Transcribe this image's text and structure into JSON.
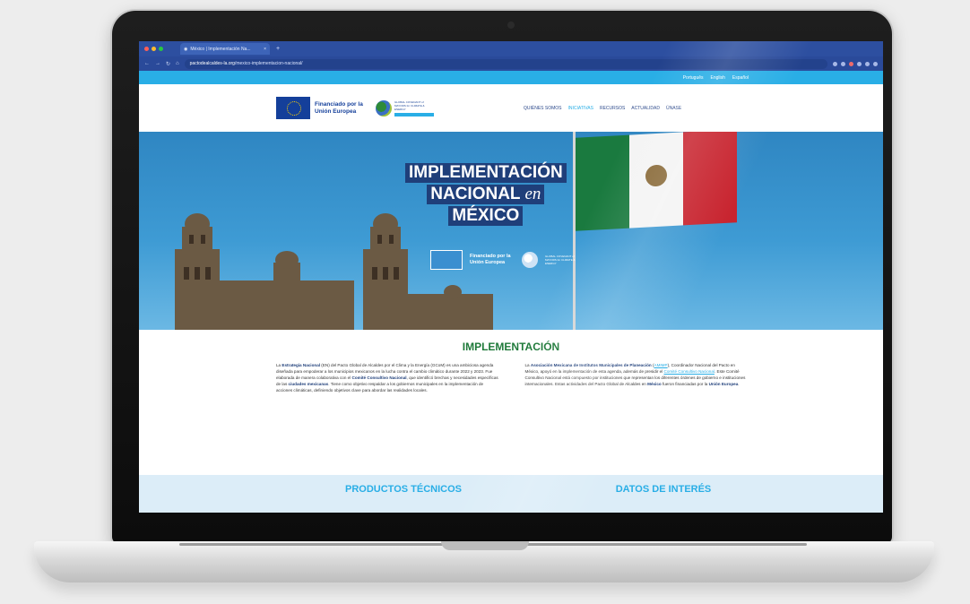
{
  "browser": {
    "tab_title": "México | Implementación Na...",
    "new_tab": "+",
    "url_domain": "pactodealcaldes-la.org",
    "url_path": "/mexico-implementacion-nacional/"
  },
  "lang_bar": [
    "Português",
    "English",
    "Español"
  ],
  "eu_logo": {
    "text": "Financiado por la Unión Europea"
  },
  "gcom_logo": {
    "text": "GLOBAL COVENANT of MAYORS for CLIMATE & ENERGY"
  },
  "nav": {
    "items": [
      {
        "label": "QUIÉNES SOMOS",
        "active": false
      },
      {
        "label": "INICIATIVAS",
        "active": true
      },
      {
        "label": "RECURSOS",
        "active": false
      },
      {
        "label": "ACTUALIDAD",
        "active": false
      },
      {
        "label": "ÚNASE",
        "active": false
      }
    ]
  },
  "hero": {
    "line1": "IMPLEMENTACIÓN",
    "line2a": "NACIONAL",
    "line2b": "en",
    "line3": "MÉXICO",
    "eu_text": "Financiado por la Unión Europea",
    "gcom_text": "GLOBAL COVENANT of MAYORS for CLIMATE & ENERGY"
  },
  "section": {
    "title": "IMPLEMENTACIÓN",
    "col1": [
      {
        "t": "La ",
        "s": "n"
      },
      {
        "t": "Estrategia Nacional",
        "s": "b"
      },
      {
        "t": " (EN) del Pacto Global de Alcaldes por el Clima y la Energía (GCoM) es una ambiciosa agenda diseñada para empoderar a los municipios mexicanos en la lucha contra el cambio climático durante 2022 y 2023. Fue elaborada de manera colaborativa con el ",
        "s": "n"
      },
      {
        "t": "Comité Consultivo Nacional",
        "s": "b"
      },
      {
        "t": ", que identificó brechas y necesidades específicas de las ",
        "s": "n"
      },
      {
        "t": "ciudades mexicanas",
        "s": "b"
      },
      {
        "t": ". Tiene como objetivo respaldar a los gobiernos municipales en la implementación de acciones climáticas, definiendo objetivos clave para abordar las realidades locales.",
        "s": "n"
      }
    ],
    "col2": [
      {
        "t": "La ",
        "s": "n"
      },
      {
        "t": "Asociación Mexicana de Institutos Municipales de Planeación",
        "s": "b"
      },
      {
        "t": " (",
        "s": "n"
      },
      {
        "t": "AMIMP",
        "s": "l"
      },
      {
        "t": "), Coordinador Nacional del Pacto en México, apoyó en la implementación de esta agenda, además de presidir el ",
        "s": "n"
      },
      {
        "t": "Comité Consultivo Nacional",
        "s": "l"
      },
      {
        "t": ". Este Comité Consultivo Nacional está compuesto por instituciones que representan los diferentes órdenes de gobierno e instituciones internacionales. Estas actividades del Pacto Global de Alcaldes en ",
        "s": "n"
      },
      {
        "t": "México",
        "s": "b"
      },
      {
        "t": " fueron financiadas por la ",
        "s": "n"
      },
      {
        "t": "Unión Europea",
        "s": "b"
      },
      {
        "t": ".",
        "s": "n"
      }
    ]
  },
  "bottom": {
    "left": "PRODUCTOS TÉCNICOS",
    "right": "DATOS DE INTERÉS"
  },
  "colors": {
    "accent": "#29aee6",
    "navy": "#1f3f7a",
    "green": "#1f7a3a",
    "browser": "#2d4fa0"
  }
}
